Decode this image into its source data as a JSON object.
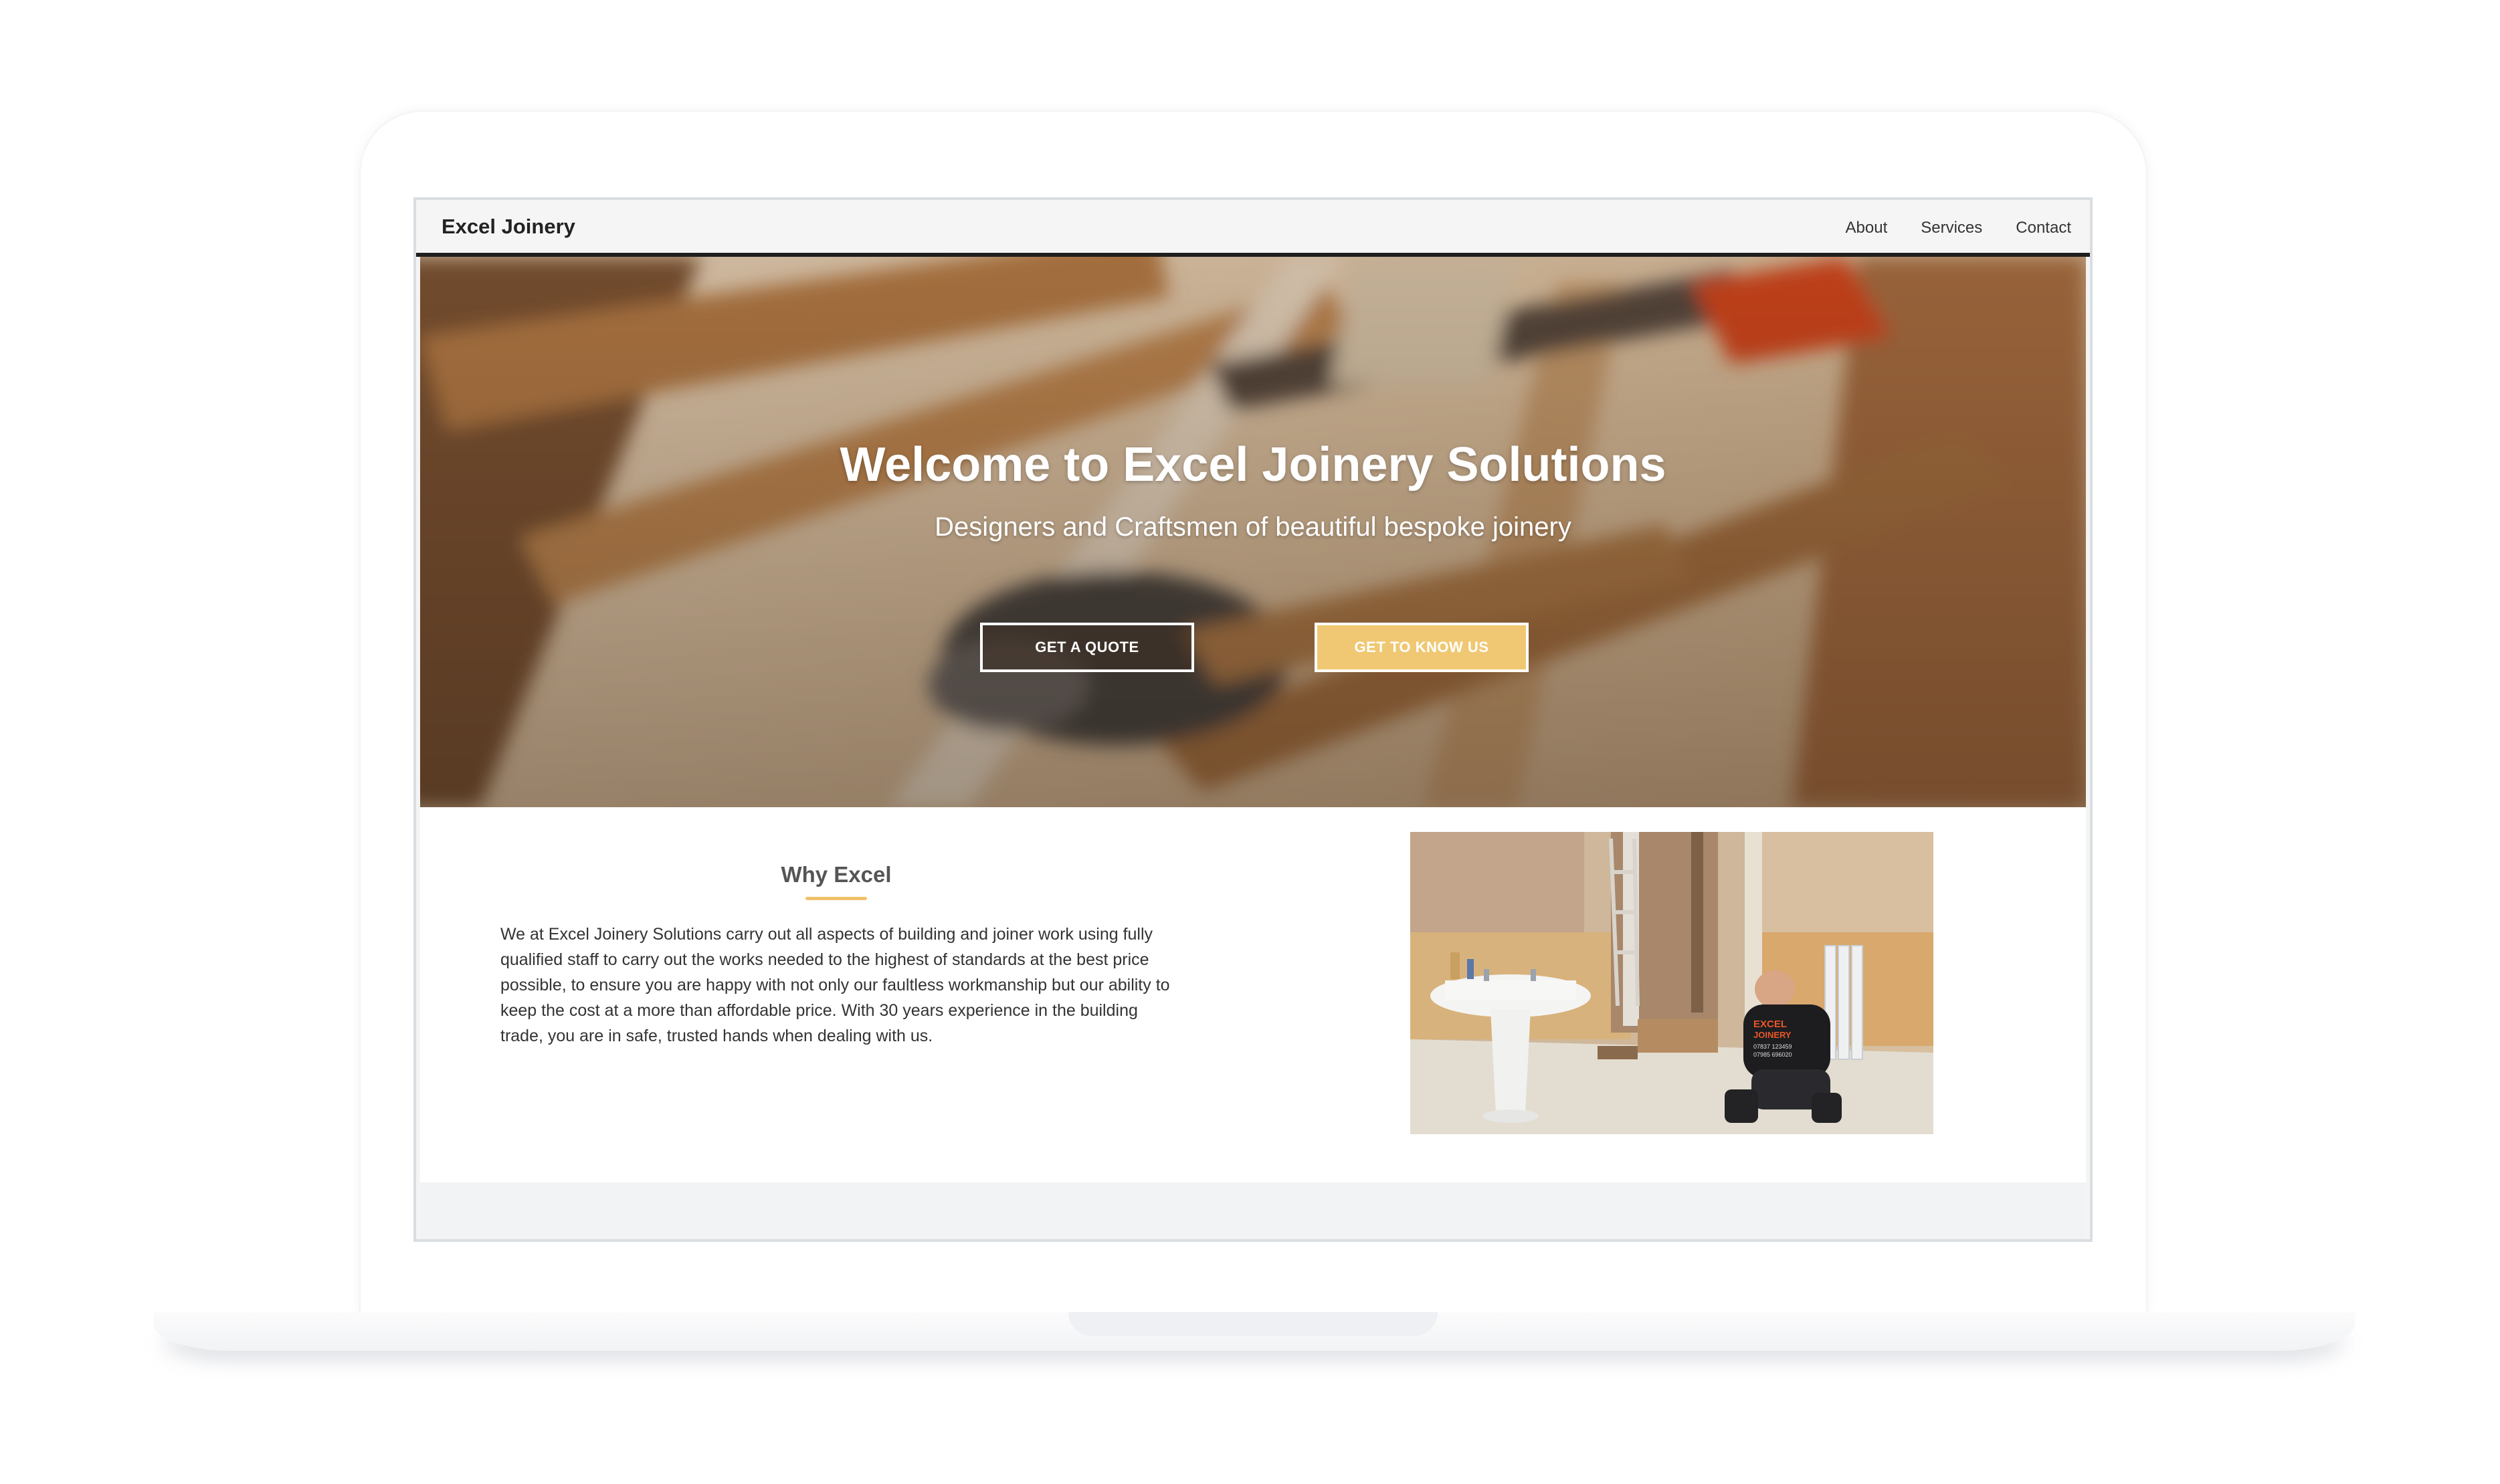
{
  "navbar": {
    "brand": "Excel Joinery",
    "links": [
      "About",
      "Services",
      "Contact"
    ]
  },
  "hero": {
    "title": "Welcome to Excel Joinery Solutions",
    "subtitle": "Designers and Craftsmen of beautiful bespoke joinery",
    "primary_button": "GET A QUOTE",
    "secondary_button": "GET TO KNOW US"
  },
  "why": {
    "title": "Why Excel",
    "text": "We at Excel Joinery Solutions carry out all aspects of building and joiner work using fully qualified staff to carry out the works needed to the highest of standards at the best price possible, to ensure you are happy with not only our faultless workmanship but our ability to keep the cost at a more than affordable price. With 30 years experience in the building trade, you are in safe, trusted hands when dealing with us.",
    "photo": {
      "shirt_text": [
        "EXCEL",
        "JOINERY",
        "07837 123459",
        "07985 696020"
      ]
    }
  },
  "colors": {
    "accent": "#f0c873",
    "underline": "#f0c16b",
    "nav_bg": "#f5f5f5",
    "nav_border": "#1f1f1f",
    "text": "#333333"
  }
}
